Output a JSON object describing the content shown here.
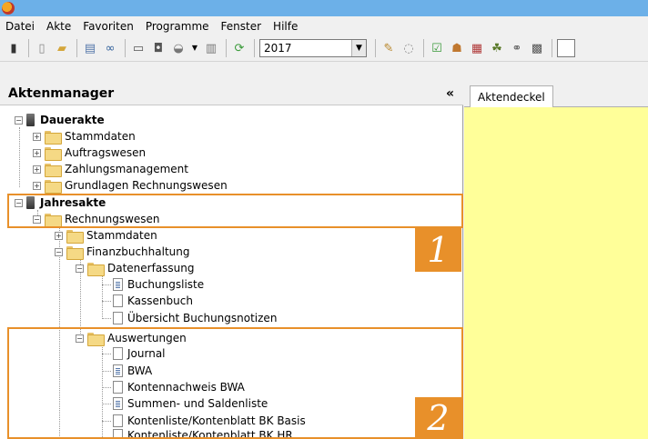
{
  "menu": [
    "Datei",
    "Akte",
    "Favoriten",
    "Programme",
    "Fenster",
    "Hilfe"
  ],
  "toolbar": {
    "year": "2017",
    "icons": [
      "drawer-icon",
      "new-document-icon",
      "open-folder-icon",
      "properties-icon",
      "binoculars-icon",
      "print-icon",
      "print-preview-icon",
      "send-icon",
      "dropdown-arrow-icon",
      "list-icon",
      "refresh-icon",
      "edit-icon",
      "history-icon",
      "check-icon",
      "users-icon",
      "calendar-icon",
      "group-icon",
      "link-icon",
      "calculator-icon"
    ]
  },
  "panel": {
    "title": "Aktenmanager",
    "collapse": "«"
  },
  "tree": [
    {
      "label": "Dauerakte"
    },
    {
      "label": "Stammdaten"
    },
    {
      "label": "Auftragswesen"
    },
    {
      "label": "Zahlungsmanagement"
    },
    {
      "label": "Grundlagen Rechnungswesen"
    },
    {
      "label": "Jahresakte"
    },
    {
      "label": "Rechnungswesen"
    },
    {
      "label": "Stammdaten"
    },
    {
      "label": "Finanzbuchhaltung"
    },
    {
      "label": "Datenerfassung"
    },
    {
      "label": "Buchungsliste"
    },
    {
      "label": "Kassenbuch"
    },
    {
      "label": "Übersicht Buchungsnotizen"
    },
    {
      "label": "Auswertungen"
    },
    {
      "label": "Journal"
    },
    {
      "label": "BWA"
    },
    {
      "label": "Kontennachweis BWA"
    },
    {
      "label": "Summen- und Saldenliste"
    },
    {
      "label": "Kontenliste/Kontenblatt BK Basis"
    },
    {
      "label": "Kontenliste/Kontenblatt BK HR"
    }
  ],
  "badges": [
    "1",
    "2"
  ],
  "tab": {
    "label": "Aktendeckel"
  },
  "colors": {
    "highlight": "#e8902a",
    "content_bg": "#ffff99",
    "titlebar": "#6cb0e8"
  }
}
